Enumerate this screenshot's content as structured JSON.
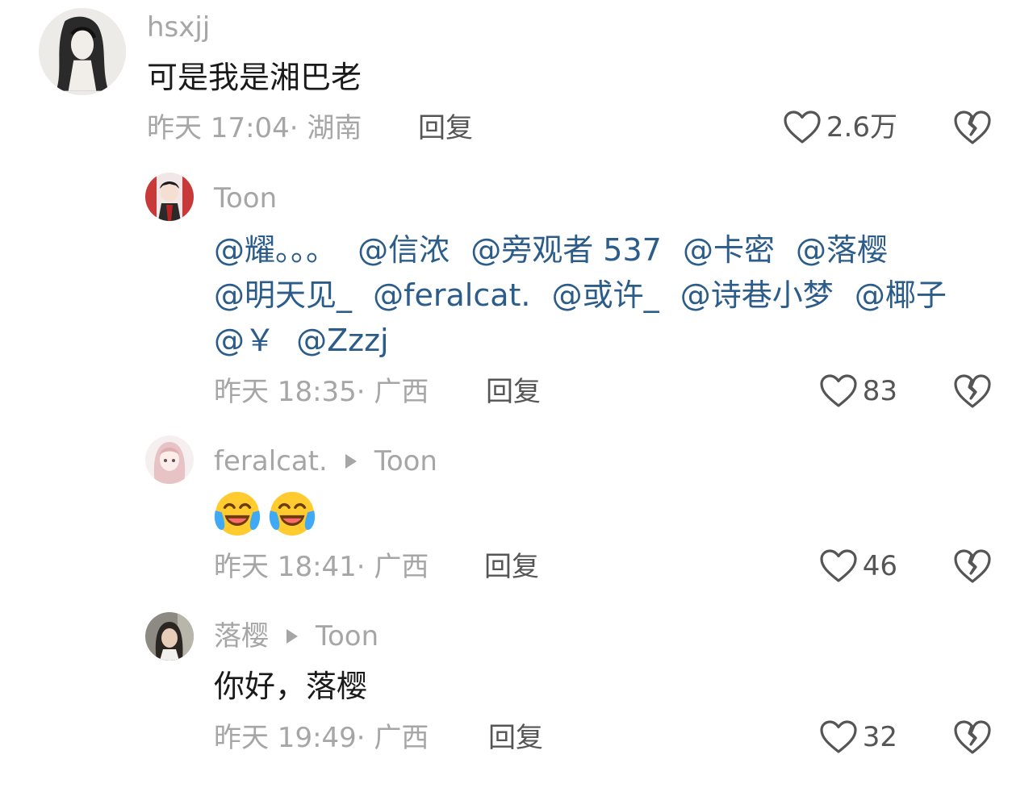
{
  "comments": [
    {
      "username": "hsxjj",
      "text": "可是我是湘巴老",
      "time": "昨天 17:04",
      "location": "湖南",
      "reply_label": "回复",
      "likes": "2.6万",
      "avatar": "anime-girl-sketch-avatar"
    },
    {
      "username": "Toon",
      "mentions": [
        "@耀。。。",
        "@信浓",
        "@旁观者 537",
        "@卡密",
        "@落樱",
        "@明天见_",
        "@feralcat.",
        "@或许_",
        "@诗巷小梦",
        "@椰子",
        "@￥",
        "@Zzzj"
      ],
      "time": "昨天 18:35",
      "location": "广西",
      "reply_label": "回复",
      "likes": "83",
      "avatar": "anime-character-red-avatar"
    },
    {
      "username": "feralcat.",
      "reply_to": "Toon",
      "emoji": [
        "laughing-crying-emoji",
        "laughing-crying-emoji"
      ],
      "time": "昨天 18:41",
      "location": "广西",
      "reply_label": "回复",
      "likes": "46",
      "avatar": "pink-hair-girl-avatar"
    },
    {
      "username": "落樱",
      "reply_to": "Toon",
      "text": "你好，落樱",
      "time": "昨天 19:49",
      "location": "广西",
      "reply_label": "回复",
      "likes": "32",
      "avatar": "photo-girl-avatar"
    }
  ],
  "colors": {
    "meta_gray": "#a6a6a6",
    "mention_blue": "#2b5c8a",
    "text_dark": "#1a1a1a"
  }
}
